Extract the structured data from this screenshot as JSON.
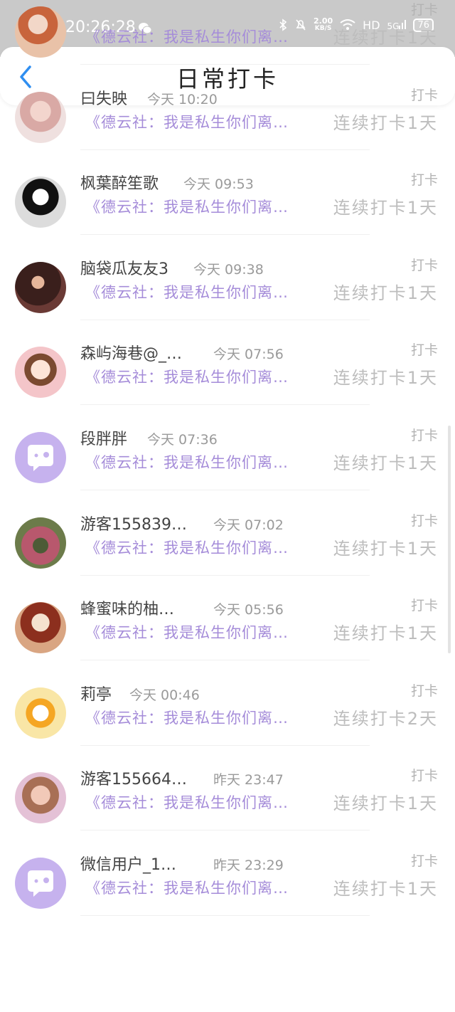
{
  "status_bar": {
    "time": "20:26:28",
    "speed_value": "2.00",
    "speed_unit": "KB/S",
    "hd_label": "HD",
    "network": "5G",
    "battery": "76"
  },
  "header": {
    "title": "日常打卡"
  },
  "colors": {
    "accent": "#a58cd9",
    "back_icon": "#2f8ef0",
    "status_bar": "#c9c9c9"
  },
  "records": [
    {
      "name": "",
      "time": "",
      "tag": "打卡",
      "quote": "《德云社：我是私生你们离…",
      "streak": "连续打卡1天",
      "avatar": "photo"
    },
    {
      "name": "曰失映",
      "time": "今天 10:20",
      "tag": "打卡",
      "quote": "《德云社：我是私生你们离…",
      "streak": "连续打卡1天",
      "avatar": "photo"
    },
    {
      "name": "枫葉醉笙歌",
      "time": "今天 09:53",
      "tag": "打卡",
      "quote": "《德云社：我是私生你们离…",
      "streak": "连续打卡1天",
      "avatar": "photo"
    },
    {
      "name": "脑袋瓜友友3",
      "time": "今天 09:38",
      "tag": "打卡",
      "quote": "《德云社：我是私生你们离…",
      "streak": "连续打卡1天",
      "avatar": "photo"
    },
    {
      "name": "森屿海巷@_…",
      "time": "今天 07:56",
      "tag": "打卡",
      "quote": "《德云社：我是私生你们离…",
      "streak": "连续打卡1天",
      "avatar": "photo"
    },
    {
      "name": "段胖胖",
      "time": "今天 07:36",
      "tag": "打卡",
      "quote": "《德云社：我是私生你们离…",
      "streak": "连续打卡1天",
      "avatar": "default"
    },
    {
      "name": "游客155839…",
      "time": "今天 07:02",
      "tag": "打卡",
      "quote": "《德云社：我是私生你们离…",
      "streak": "连续打卡1天",
      "avatar": "photo"
    },
    {
      "name": "蜂蜜味的柚…",
      "time": "今天 05:56",
      "tag": "打卡",
      "quote": "《德云社：我是私生你们离…",
      "streak": "连续打卡1天",
      "avatar": "photo"
    },
    {
      "name": "莉亭",
      "time": "今天 00:46",
      "tag": "打卡",
      "quote": "《德云社：我是私生你们离…",
      "streak": "连续打卡2天",
      "avatar": "photo"
    },
    {
      "name": "游客155664…",
      "time": "昨天 23:47",
      "tag": "打卡",
      "quote": "《德云社：我是私生你们离…",
      "streak": "连续打卡1天",
      "avatar": "photo"
    },
    {
      "name": "微信用户_1…",
      "time": "昨天 23:29",
      "tag": "打卡",
      "quote": "《德云社：我是私生你们离…",
      "streak": "连续打卡1天",
      "avatar": "default"
    }
  ]
}
